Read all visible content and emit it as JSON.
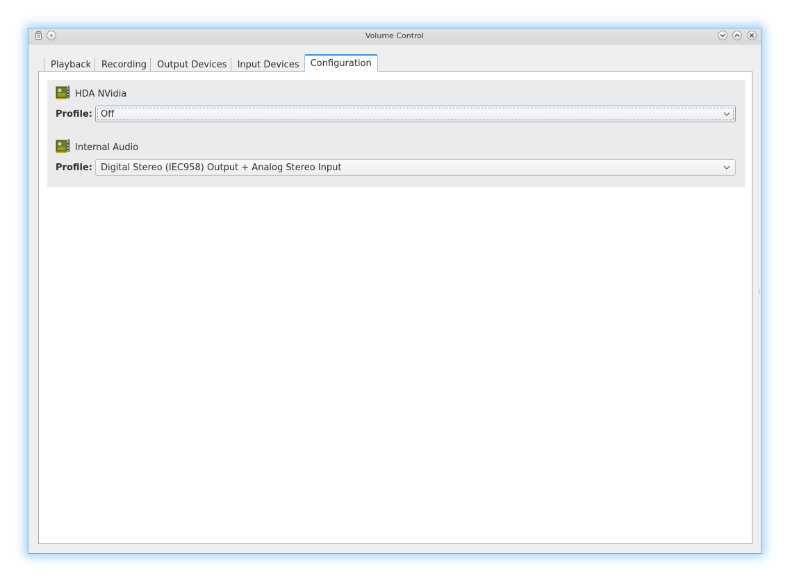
{
  "window": {
    "title": "Volume Control"
  },
  "tabs": [
    {
      "label": "Playback",
      "active": false
    },
    {
      "label": "Recording",
      "active": false
    },
    {
      "label": "Output Devices",
      "active": false
    },
    {
      "label": "Input Devices",
      "active": false
    },
    {
      "label": "Configuration",
      "active": true
    }
  ],
  "cards": [
    {
      "name": "HDA NVidia",
      "icon": "sound-card-icon",
      "profile_label": "Profile:",
      "profile_value": "Off"
    },
    {
      "name": "Internal Audio",
      "icon": "sound-card-icon",
      "profile_label": "Profile:",
      "profile_value": "Digital Stereo (IEC958) Output + Analog Stereo Input"
    }
  ],
  "colors": {
    "accent": "#3b8fd9",
    "window_glow": "#50aaf0",
    "panel_bg": "#ebebeb"
  }
}
